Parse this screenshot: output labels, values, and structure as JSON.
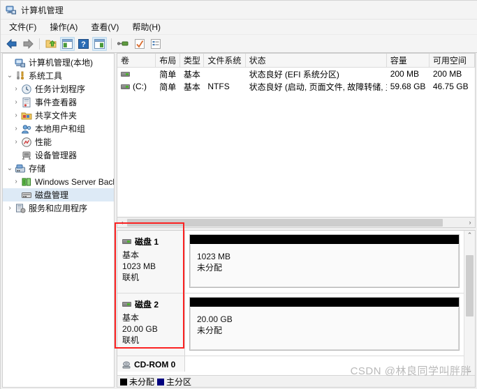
{
  "window": {
    "title": "计算机管理",
    "icon": "computer-management-icon"
  },
  "menubar": {
    "items": [
      {
        "label": "文件(F)",
        "name": "menu-file"
      },
      {
        "label": "操作(A)",
        "name": "menu-action"
      },
      {
        "label": "查看(V)",
        "name": "menu-view"
      },
      {
        "label": "帮助(H)",
        "name": "menu-help"
      }
    ]
  },
  "toolbar": {
    "buttons": [
      {
        "name": "back-arrow-icon",
        "glyph": "←"
      },
      {
        "name": "forward-arrow-icon",
        "glyph": "→"
      },
      {
        "name": "up-folder-icon",
        "glyph": "▲"
      },
      {
        "name": "show-tree-icon",
        "glyph": "▤"
      },
      {
        "name": "help-icon",
        "glyph": "?"
      },
      {
        "name": "show-action-pane-icon",
        "glyph": "▤"
      },
      {
        "name": "refresh-icon",
        "glyph": "⌁"
      },
      {
        "name": "properties-icon",
        "glyph": "✓"
      },
      {
        "name": "export-list-icon",
        "glyph": "☰"
      }
    ]
  },
  "tree": {
    "items": [
      {
        "label": "计算机管理(本地)",
        "depth": 0,
        "expander": "",
        "icon": "computer-icon",
        "selected": false,
        "name": "tree-item-computer-management"
      },
      {
        "label": "系统工具",
        "depth": 0,
        "expander": "⌄",
        "icon": "system-tools-icon",
        "selected": false,
        "name": "tree-item-system-tools"
      },
      {
        "label": "任务计划程序",
        "depth": 1,
        "expander": "›",
        "icon": "task-scheduler-icon",
        "selected": false,
        "name": "tree-item-task-scheduler"
      },
      {
        "label": "事件查看器",
        "depth": 1,
        "expander": "›",
        "icon": "event-viewer-icon",
        "selected": false,
        "name": "tree-item-event-viewer"
      },
      {
        "label": "共享文件夹",
        "depth": 1,
        "expander": "›",
        "icon": "shared-folders-icon",
        "selected": false,
        "name": "tree-item-shared-folders"
      },
      {
        "label": "本地用户和组",
        "depth": 1,
        "expander": "›",
        "icon": "local-users-icon",
        "selected": false,
        "name": "tree-item-local-users-and-groups"
      },
      {
        "label": "性能",
        "depth": 1,
        "expander": "›",
        "icon": "performance-icon",
        "selected": false,
        "name": "tree-item-performance"
      },
      {
        "label": "设备管理器",
        "depth": 1,
        "expander": "",
        "icon": "device-manager-icon",
        "selected": false,
        "name": "tree-item-device-manager"
      },
      {
        "label": "存储",
        "depth": 0,
        "expander": "⌄",
        "icon": "storage-icon",
        "selected": false,
        "name": "tree-item-storage"
      },
      {
        "label": "Windows Server Back",
        "depth": 1,
        "expander": "›",
        "icon": "windows-server-backup-icon",
        "selected": false,
        "name": "tree-item-windows-server-backup"
      },
      {
        "label": "磁盘管理",
        "depth": 1,
        "expander": "",
        "icon": "disk-management-icon",
        "selected": true,
        "name": "tree-item-disk-management"
      },
      {
        "label": "服务和应用程序",
        "depth": 0,
        "expander": "›",
        "icon": "services-and-applications-icon",
        "selected": false,
        "name": "tree-item-services-and-applications"
      }
    ]
  },
  "volume_list": {
    "columns": [
      {
        "label": "卷",
        "key": "volume"
      },
      {
        "label": "布局",
        "key": "layout"
      },
      {
        "label": "类型",
        "key": "type"
      },
      {
        "label": "文件系统",
        "key": "filesystem"
      },
      {
        "label": "状态",
        "key": "status"
      },
      {
        "label": "容量",
        "key": "capacity"
      },
      {
        "label": "可用空间",
        "key": "free_space"
      }
    ],
    "rows": [
      {
        "volume": "",
        "layout": "简单",
        "type": "基本",
        "filesystem": "",
        "status": "状态良好 (EFI 系统分区)",
        "capacity": "200 MB",
        "free_space": "200 MB"
      },
      {
        "volume": "(C:)",
        "layout": "简单",
        "type": "基本",
        "filesystem": "NTFS",
        "status": "状态良好 (启动, 页面文件, 故障转储, 主分区)",
        "capacity": "59.68 GB",
        "free_space": "46.75 GB"
      }
    ]
  },
  "disks": [
    {
      "name": "磁盘 1",
      "type": "基本",
      "size": "1023 MB",
      "state": "联机",
      "partitions": [
        {
          "size": "1023 MB",
          "label": "未分配",
          "kind": "unallocated"
        }
      ]
    },
    {
      "name": "磁盘 2",
      "type": "基本",
      "size": "20.00 GB",
      "state": "联机",
      "partitions": [
        {
          "size": "20.00 GB",
          "label": "未分配",
          "kind": "unallocated"
        }
      ]
    }
  ],
  "cdrom": {
    "name": "CD-ROM 0"
  },
  "legend": {
    "items": [
      {
        "label": "未分配",
        "color": "#000000",
        "name": "legend-unallocated"
      },
      {
        "label": "主分区",
        "color": "#00007e",
        "name": "legend-primary-partition"
      }
    ]
  },
  "watermark": {
    "text": "CSDN @林良同学叫胖胖"
  },
  "colors": {
    "selection": "#ddeaf6",
    "annotation": "#fb2222",
    "unallocated": "#000000",
    "primary": "#00007e"
  }
}
